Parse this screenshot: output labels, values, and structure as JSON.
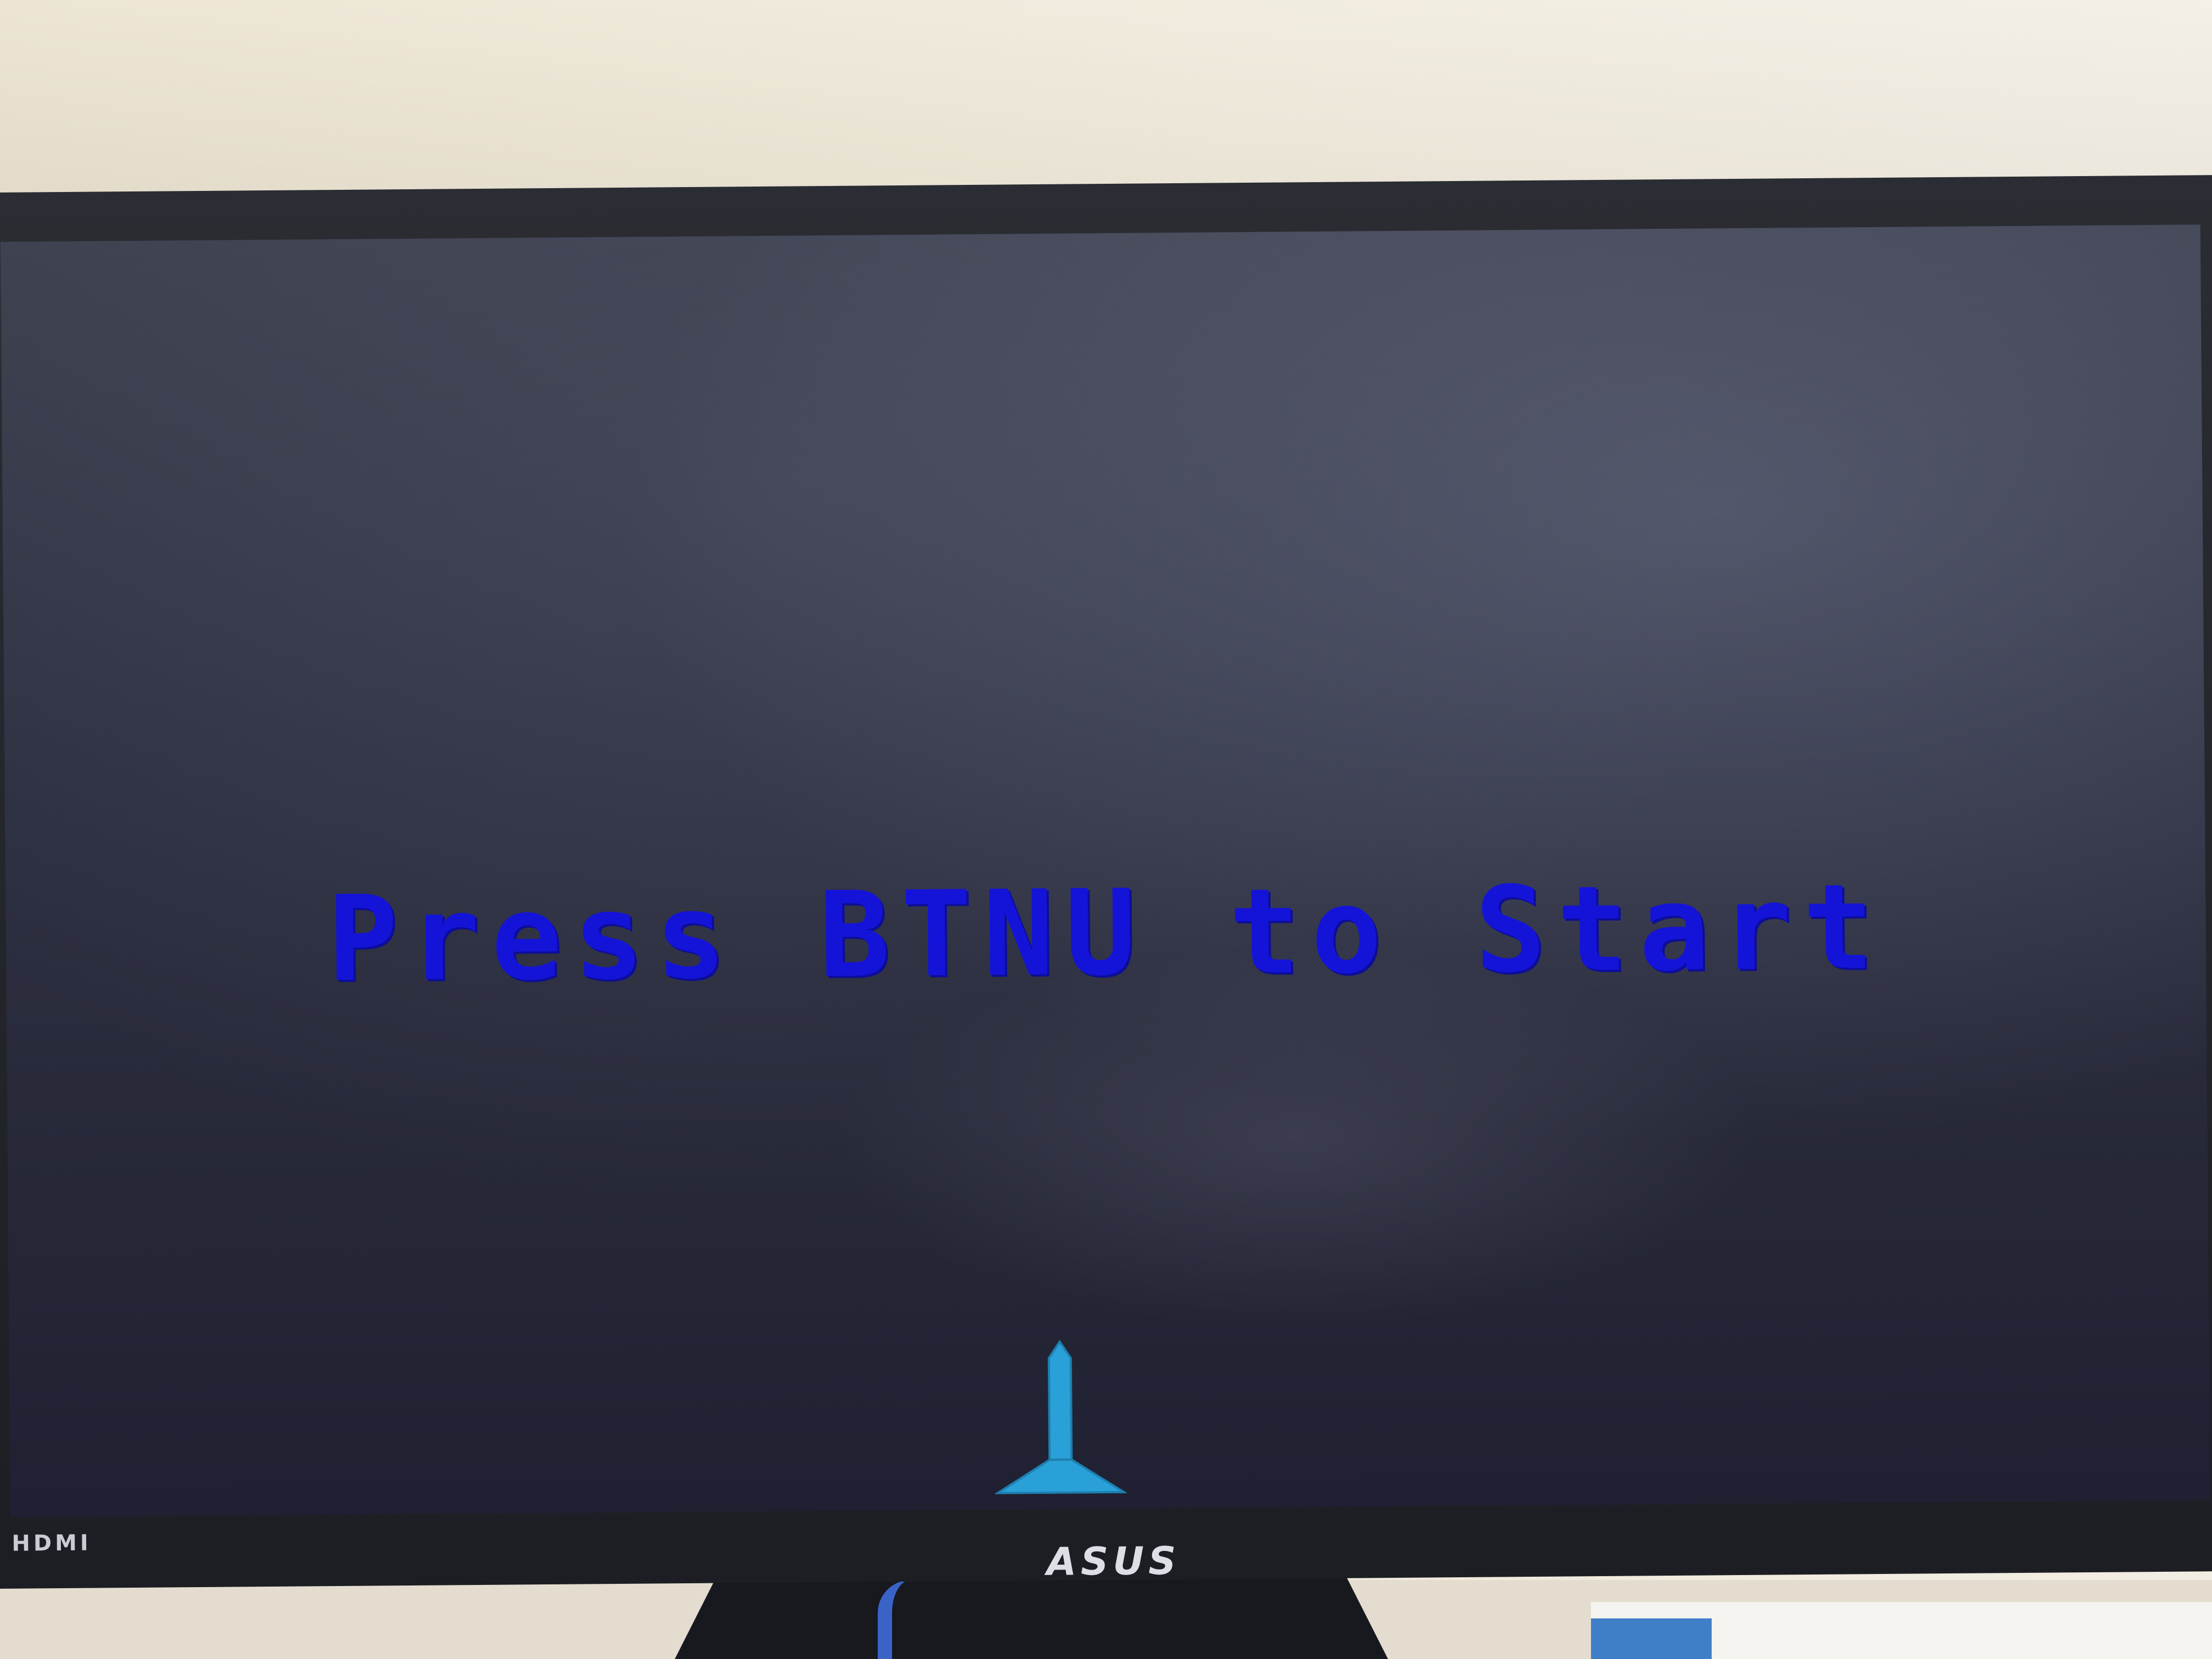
{
  "screen": {
    "prompt_text": "Press BTNU to Start",
    "text_color": "#1414d8",
    "player_ship_color": "#2aa0d8"
  },
  "monitor": {
    "input_label": "HDMI",
    "brand_logo": "ASUS"
  },
  "icons": {
    "player_ship": "rocket-ship-icon"
  }
}
